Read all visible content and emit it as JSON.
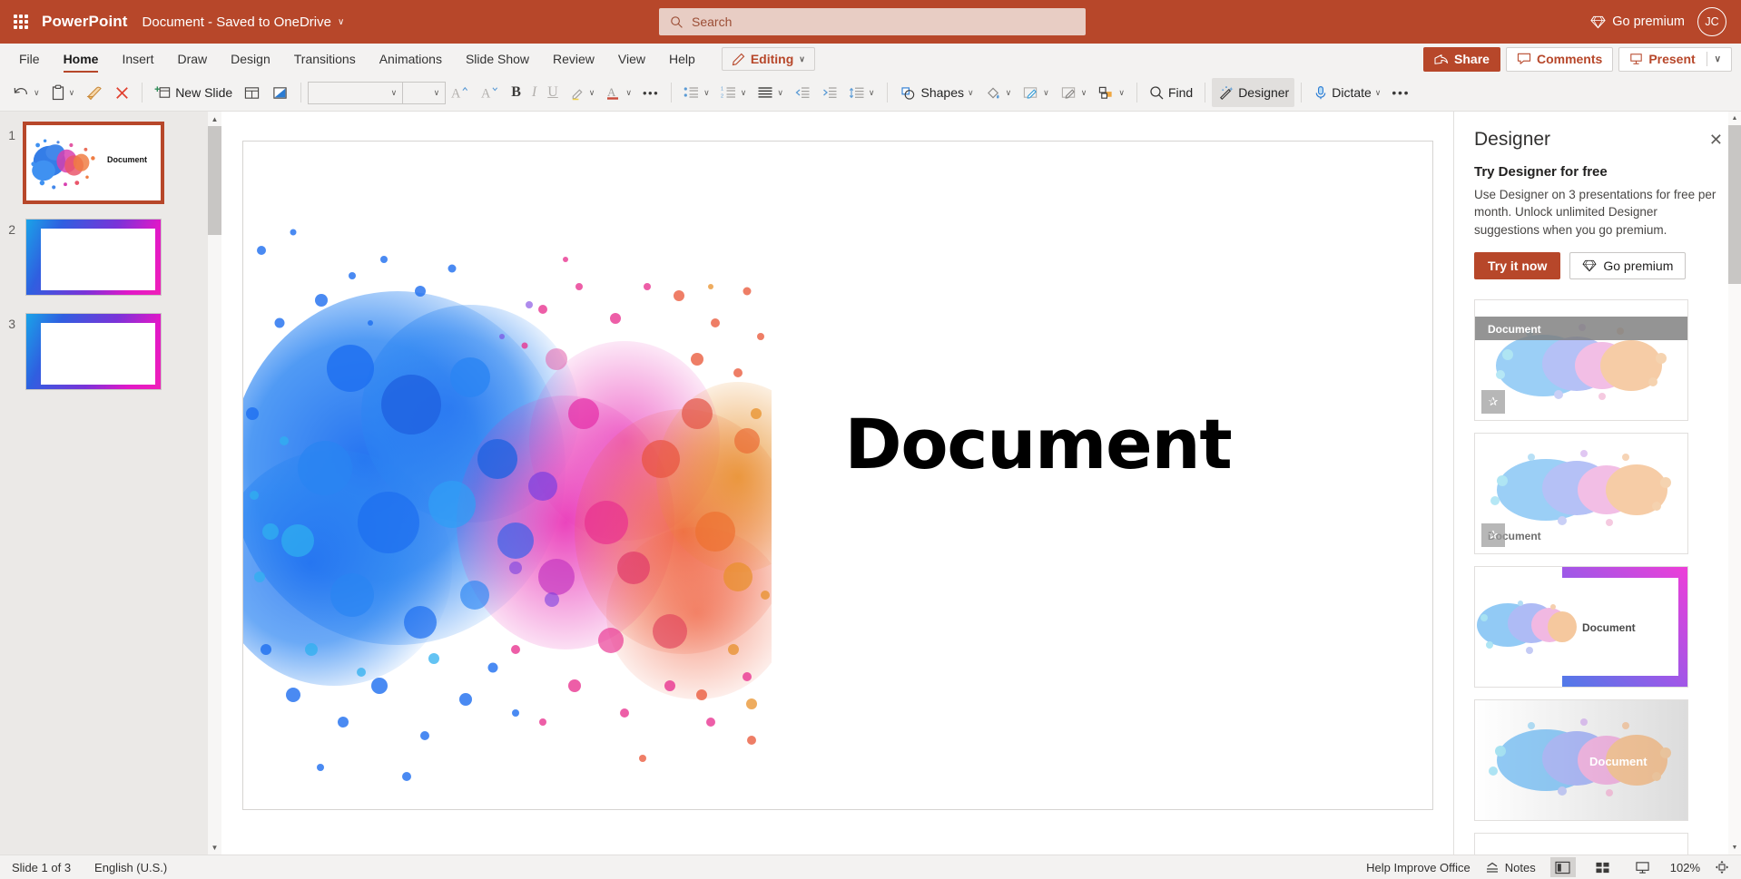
{
  "titlebar": {
    "waffle_label": "app-launcher",
    "brand": "PowerPoint",
    "doc_title": "Document  -  Saved to OneDrive",
    "doc_chevron": "∨",
    "go_premium": "Go premium",
    "avatar_initials": "JC"
  },
  "search": {
    "placeholder": "Search",
    "value": ""
  },
  "ribbon": {
    "tabs": [
      {
        "label": "File",
        "active": false
      },
      {
        "label": "Home",
        "active": true
      },
      {
        "label": "Insert",
        "active": false
      },
      {
        "label": "Draw",
        "active": false
      },
      {
        "label": "Design",
        "active": false
      },
      {
        "label": "Transitions",
        "active": false
      },
      {
        "label": "Animations",
        "active": false
      },
      {
        "label": "Slide Show",
        "active": false
      },
      {
        "label": "Review",
        "active": false
      },
      {
        "label": "View",
        "active": false
      },
      {
        "label": "Help",
        "active": false
      }
    ],
    "editing_label": "Editing",
    "editing_chevron": "∨",
    "share_label": "Share",
    "comments_label": "Comments",
    "present_label": "Present",
    "present_chevron": "∨"
  },
  "toolbar": {
    "undo_chevron": "∨",
    "paste_chevron": "∨",
    "new_slide_label": "New Slide",
    "font_name": "",
    "font_size": "",
    "font_name_chevron": "∨",
    "font_size_chevron": "∨",
    "bold_label": "B",
    "italic_label": "I",
    "underline_label": "U",
    "more_font_label": "•••",
    "shapes_label": "Shapes",
    "find_label": "Find",
    "designer_label": "Designer",
    "dictate_label": "Dictate",
    "overflow_label": "•••"
  },
  "slides": [
    {
      "number": "1",
      "selected": true,
      "type": "splatter-title",
      "title": "Document"
    },
    {
      "number": "2",
      "selected": false,
      "type": "gradient-frame",
      "title": ""
    },
    {
      "number": "3",
      "selected": false,
      "type": "gradient-frame",
      "title": ""
    }
  ],
  "slide_canvas": {
    "title": "Document",
    "layout": "image-left-title-right"
  },
  "designer": {
    "panel_title": "Designer",
    "close_label": "✕",
    "promo": {
      "heading": "Try Designer for free",
      "body": "Use Designer on 3 presentations for free per month. Unlock unlimited Designer suggestions when you go premium.",
      "primary_button": "Try it now",
      "secondary_button": "Go premium"
    },
    "suggestions": [
      {
        "id": "1",
        "title": "Document",
        "style": "banner-top-gray",
        "selected": false
      },
      {
        "id": "2",
        "title": "Document",
        "style": "title-bottom-left",
        "selected": false
      },
      {
        "id": "3",
        "title": "Document",
        "style": "gradient-frame-split",
        "selected": false
      },
      {
        "id": "4",
        "title": "Document",
        "style": "overlay-centered-white",
        "selected": false
      }
    ]
  },
  "statusbar": {
    "slide_count": "Slide 1 of 3",
    "language": "English (U.S.)",
    "help_improve": "Help Improve Office",
    "notes_label": "Notes",
    "zoom": "102%",
    "views": [
      {
        "name": "normal-view",
        "active": true
      },
      {
        "name": "slide-sorter-view",
        "active": false
      },
      {
        "name": "reading-view",
        "active": false
      }
    ]
  },
  "colors": {
    "brand": "#b7472a",
    "titlebar": "#b7472a",
    "ribbon_bg": "#f3f2f1",
    "search_bg": "#e8cdc4",
    "accent_blue": "#1f6fe5",
    "accent_magenta": "#e8189e",
    "accent_orange": "#e8732a"
  }
}
